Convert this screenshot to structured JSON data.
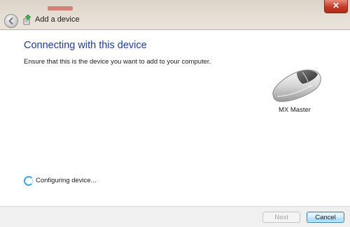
{
  "window": {
    "title": "Add a device",
    "close_glyph": "✕"
  },
  "page": {
    "heading": "Connecting with this device",
    "instruction": "Ensure that this is the device you want to add to your computer."
  },
  "device": {
    "name": "MX Master",
    "icon": "mouse-icon"
  },
  "status": {
    "text": "Configuring device...",
    "icon": "spinner-icon"
  },
  "footer": {
    "next_label": "Next",
    "cancel_label": "Cancel"
  },
  "colors": {
    "heading": "#1e3b9a",
    "spinner": "#3aa6e0",
    "close": "#c43b27"
  }
}
